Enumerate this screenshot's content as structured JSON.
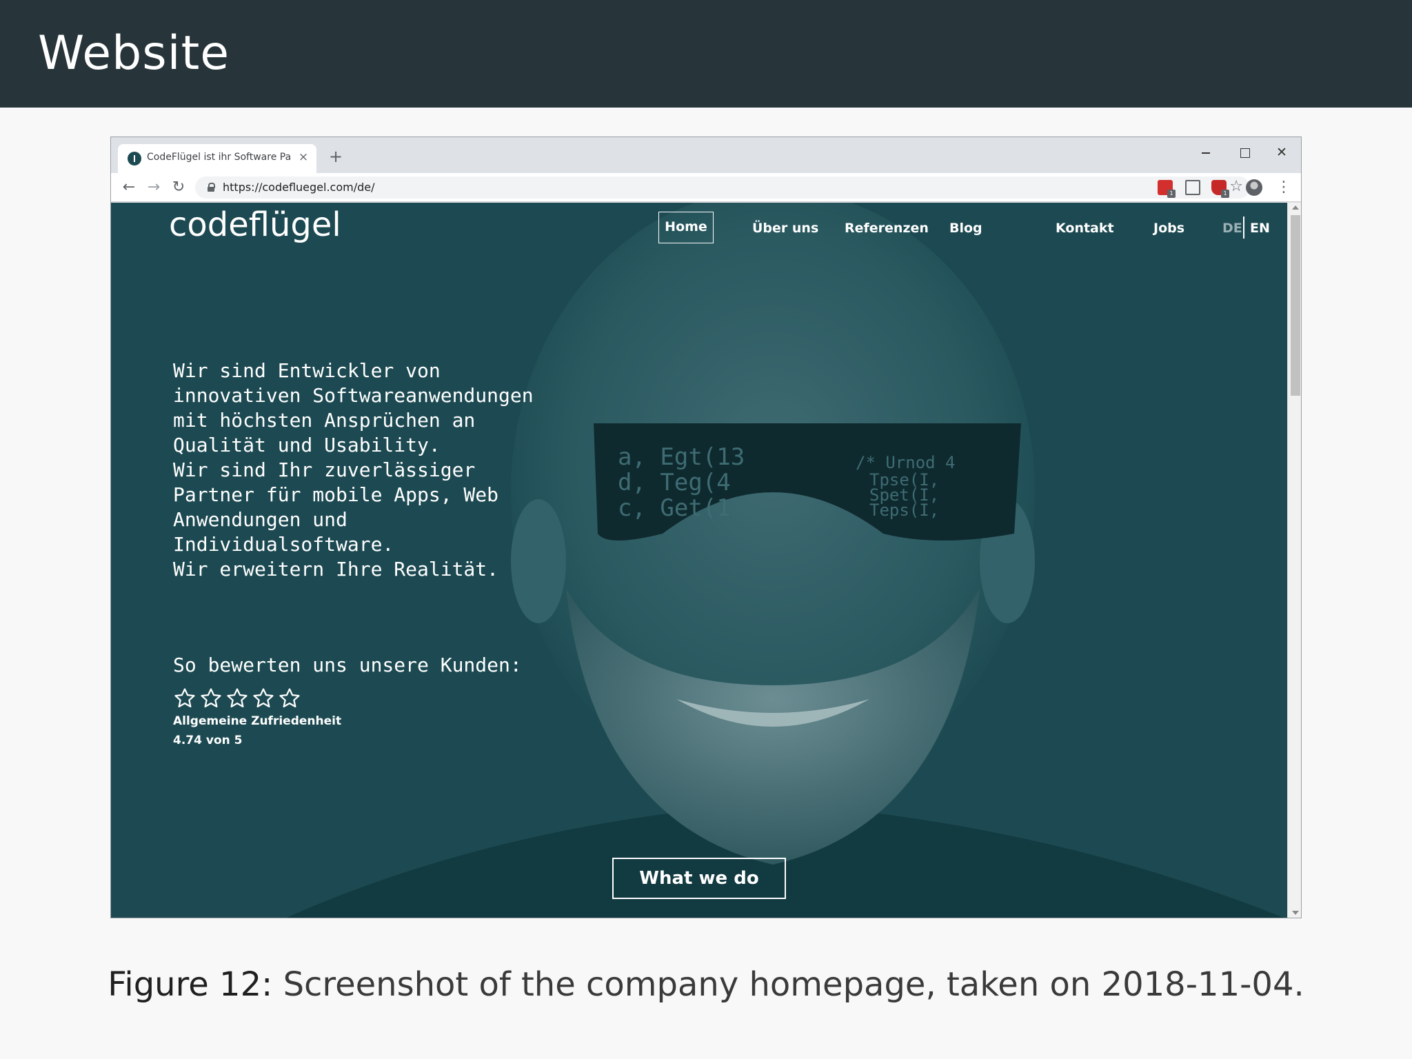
{
  "slide": {
    "title": "Website",
    "caption_label": "Figure 12:",
    "caption_text": "Screenshot of the company homepage, taken on 2018-11-04."
  },
  "browser": {
    "tab_title": "CodeFlügel ist ihr Software Partn",
    "tab_close": "×",
    "new_tab": "+",
    "url": "https://codefluegel.com/de/",
    "window_close": "✕"
  },
  "site": {
    "logo": "codeflügel",
    "nav": {
      "home": "Home",
      "about": "Über uns",
      "references": "Referenzen",
      "blog": "Blog",
      "contact": "Kontakt",
      "jobs": "Jobs"
    },
    "lang_de": "DE",
    "lang_en": "EN",
    "hero_text": "Wir sind Entwickler von\ninnovativen Softwareanwendungen\nmit höchsten Ansprüchen an\nQualität und Usability.\nWir sind Ihr zuverlässiger\nPartner für mobile Apps, Web\nAnwendungen und\nIndividualsoftware.\nWir erweitern Ihre Realität.",
    "rating_heading": "So bewerten uns unsere Kunden:",
    "rating_stars": 5,
    "rating_label": "Allgemeine Zufriedenheit",
    "rating_value": "4.74 von 5",
    "cta": "What we do"
  },
  "colors": {
    "slide_header": "#27353a",
    "hero_background": "#1d4a52",
    "browser_chrome": "#dee1e6"
  }
}
